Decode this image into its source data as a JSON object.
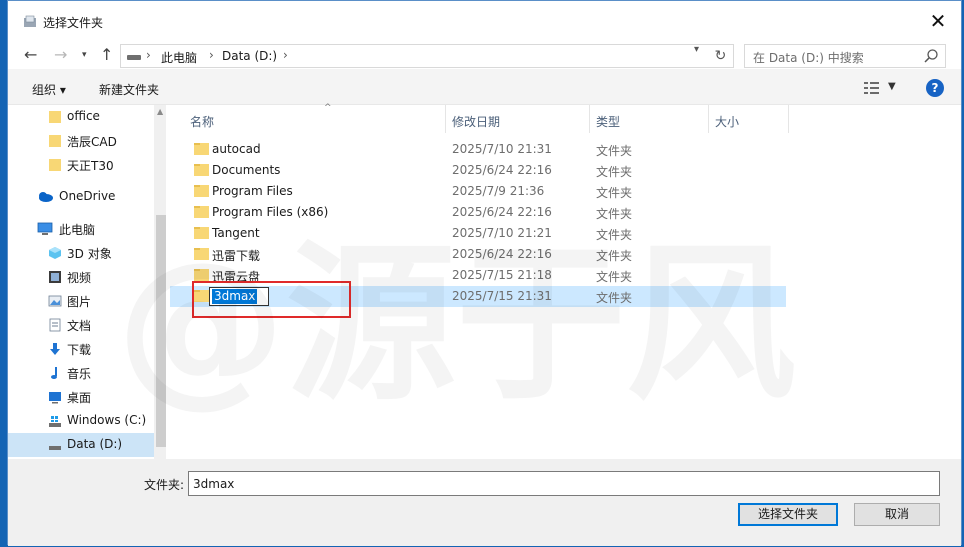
{
  "window": {
    "title": "选择文件夹"
  },
  "address": {
    "parts": [
      "此电脑",
      "Data (D:)"
    ]
  },
  "search": {
    "placeholder": "在 Data (D:) 中搜索"
  },
  "toolbar": {
    "organize": "组织 ▾",
    "new_folder": "新建文件夹"
  },
  "nav": {
    "items": [
      {
        "label": "office",
        "icon": "folder-icon"
      },
      {
        "label": "浩辰CAD",
        "icon": "folder-icon"
      },
      {
        "label": "天正T30",
        "icon": "folder-icon"
      },
      {
        "label": "OneDrive",
        "icon": "cloud-icon"
      },
      {
        "label": "此电脑",
        "icon": "computer-icon"
      },
      {
        "label": "3D 对象",
        "icon": "3d-objects-icon"
      },
      {
        "label": "视频",
        "icon": "video-icon"
      },
      {
        "label": "图片",
        "icon": "pictures-icon"
      },
      {
        "label": "文档",
        "icon": "documents-icon"
      },
      {
        "label": "下载",
        "icon": "download-icon"
      },
      {
        "label": "音乐",
        "icon": "music-icon"
      },
      {
        "label": "桌面",
        "icon": "desktop-icon"
      },
      {
        "label": "Windows (C:)",
        "icon": "windows-drive-icon"
      },
      {
        "label": "Data (D:)",
        "icon": "drive-icon"
      }
    ]
  },
  "columns": {
    "name": "名称",
    "date": "修改日期",
    "type": "类型",
    "size": "大小"
  },
  "files": [
    {
      "name": "autocad",
      "date": "2025/7/10 21:31",
      "type": "文件夹"
    },
    {
      "name": "Documents",
      "date": "2025/6/24 22:16",
      "type": "文件夹"
    },
    {
      "name": "Program Files",
      "date": "2025/7/9 21:36",
      "type": "文件夹"
    },
    {
      "name": "Program Files (x86)",
      "date": "2025/6/24 22:16",
      "type": "文件夹"
    },
    {
      "name": "Tangent",
      "date": "2025/7/10 21:21",
      "type": "文件夹"
    },
    {
      "name": "迅雷下载",
      "date": "2025/6/24 22:16",
      "type": "文件夹"
    },
    {
      "name": "迅雷云盘",
      "date": "2025/7/15 21:18",
      "type": "文件夹"
    },
    {
      "name": "3dmax",
      "date": "2025/7/15 21:31",
      "type": "文件夹"
    }
  ],
  "bottom": {
    "folder_label": "文件夹:",
    "folder_value": "3dmax",
    "select_button": "选择文件夹",
    "cancel_button": "取消"
  },
  "watermark": {
    "text": "@源于风"
  },
  "colors": {
    "accent": "#0078d7",
    "selection": "#cce8ff",
    "highlight_box": "#e02a2a",
    "folder": "#f8d775"
  }
}
